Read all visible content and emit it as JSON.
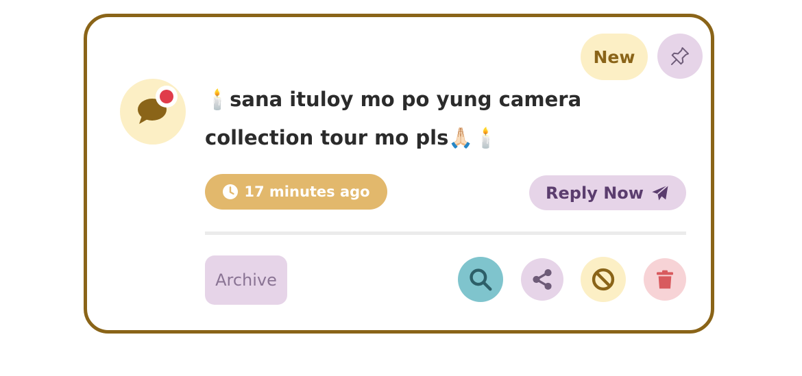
{
  "notification": {
    "badge": "New",
    "message": "🕯️sana ituloy mo po yung camera collection tour mo pls🙏🏻🕯️",
    "time": "17 minutes ago",
    "reply_label": "Reply Now",
    "archive_label": "Archive",
    "unread": true
  },
  "icons": {
    "pin": "pushpin-icon",
    "avatar": "chat-bubble-icon",
    "clock": "clock-icon",
    "reply": "paper-plane-icon",
    "search": "search-icon",
    "share": "share-icon",
    "block": "block-icon",
    "delete": "trash-icon"
  },
  "colors": {
    "border": "#8a6418",
    "badge_bg": "#fcefc5",
    "lavender": "#e6d4e8",
    "time_bg": "#e2b86c",
    "search_bg": "#7fc4cd",
    "delete_bg": "#f7d3d6",
    "unread_dot": "#e03c4a",
    "delete_icon": "#d85a5e"
  }
}
